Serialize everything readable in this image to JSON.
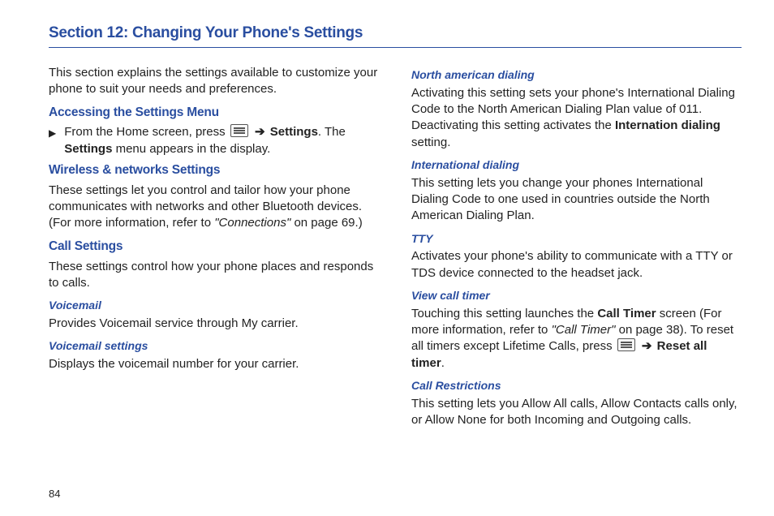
{
  "page_number": "84",
  "section_title": "Section 12: Changing Your Phone's Settings",
  "intro": "This section explains the settings available to customize your phone to suit your needs and preferences.",
  "col1": {
    "accessing": {
      "heading": "Accessing the Settings Menu",
      "bullet_pre": "From the Home screen, press ",
      "settings_label": "Settings",
      "bullet_post1": ". The ",
      "settings_label2": "Settings",
      "bullet_post2": " menu appears in the display."
    },
    "wireless": {
      "heading": "Wireless & networks Settings",
      "body_pre": "These settings let you control and tailor how your phone communicates with networks and other Bluetooth devices. (For more information, refer to ",
      "ref": "\"Connections\"",
      "body_post": " on page 69.)"
    },
    "call_settings": {
      "heading": "Call Settings",
      "body": "These settings control how your phone places and responds to calls."
    },
    "voicemail": {
      "heading": "Voicemail",
      "body": "Provides Voicemail service through My carrier."
    },
    "voicemail_settings": {
      "heading": "Voicemail settings",
      "body": "Displays the voicemail number for your carrier."
    }
  },
  "col2": {
    "na_dialing": {
      "heading": "North american dialing",
      "body_pre": "Activating this setting sets your phone's International Dialing Code to the North American Dialing Plan value of 011. Deactivating this setting activates the ",
      "bold": "Internation dialing",
      "body_post": " setting."
    },
    "intl_dialing": {
      "heading": "International dialing",
      "body": "This setting lets you change your phones International Dialing Code to one used in countries outside the North American Dialing Plan."
    },
    "tty": {
      "heading": "TTY",
      "body": "Activates your phone's ability to communicate with a TTY or TDS device connected to the headset jack."
    },
    "view_call_timer": {
      "heading": "View call timer",
      "body_pre": "Touching this setting launches the ",
      "bold1": "Call Timer",
      "body_mid1": " screen (For more information, refer to ",
      "ref": "\"Call Timer\"",
      "body_mid2": " on page 38). To reset all timers except Lifetime Calls, press ",
      "bold2": "Reset all timer",
      "body_post": "."
    },
    "call_restrictions": {
      "heading": "Call Restrictions",
      "body": "This setting lets you Allow All calls, Allow Contacts calls only, or Allow None for both Incoming and Outgoing calls."
    }
  },
  "arrow": "➔"
}
